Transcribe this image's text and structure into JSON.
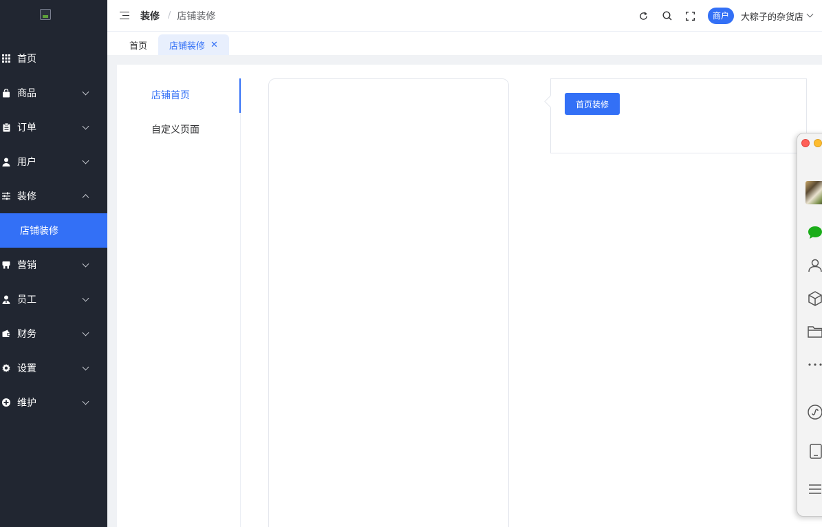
{
  "sidebar": {
    "items": [
      {
        "label": "首页",
        "icon": "grid-icon"
      },
      {
        "label": "商品",
        "icon": "shopping-bag-icon"
      },
      {
        "label": "订单",
        "icon": "clipboard-icon"
      },
      {
        "label": "用户",
        "icon": "user-icon"
      },
      {
        "label": "装修",
        "icon": "sliders-icon",
        "expanded": true
      },
      {
        "label": "店铺装修",
        "active": true
      },
      {
        "label": "营销",
        "icon": "shop-icon"
      },
      {
        "label": "员工",
        "icon": "employee-icon"
      },
      {
        "label": "财务",
        "icon": "wallet-icon"
      },
      {
        "label": "设置",
        "icon": "gear-icon"
      },
      {
        "label": "维护",
        "icon": "plus-circle-icon"
      }
    ]
  },
  "header": {
    "breadcrumb_parent": "装修",
    "breadcrumb_separator": "/",
    "breadcrumb_current": "店铺装修",
    "role_badge": "商户",
    "shop_name": "大粽子的杂货店"
  },
  "tabs": [
    {
      "label": "首页"
    },
    {
      "label": "店铺装修",
      "active": true,
      "close": "✕"
    }
  ],
  "page_nav": {
    "items": [
      {
        "label": "店铺首页",
        "active": true
      },
      {
        "label": "自定义页面"
      }
    ]
  },
  "popover": {
    "button_label": "首页装修"
  },
  "colors": {
    "sidebar_bg": "#212631",
    "accent": "#3370f6",
    "tab_active_bg": "#e8effd"
  }
}
